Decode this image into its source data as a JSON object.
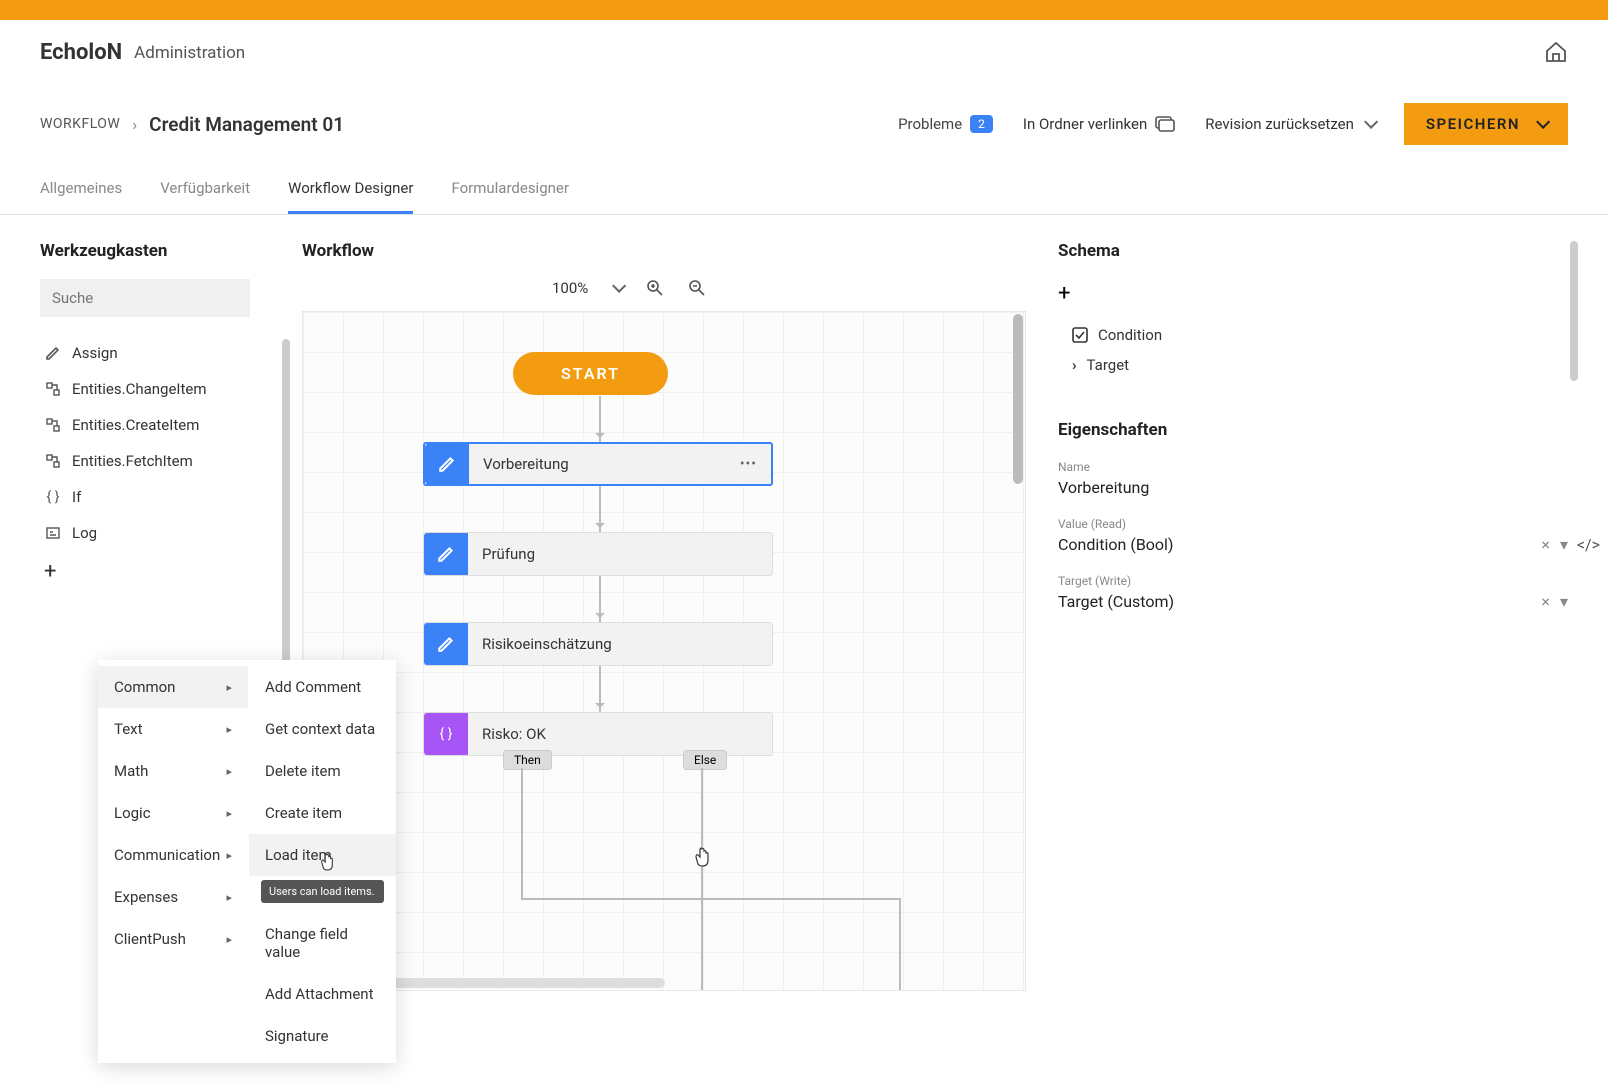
{
  "header": {
    "logo": "EcholoN",
    "admin": "Administration"
  },
  "breadcrumb": {
    "root": "WORKFLOW",
    "title": "Credit Management 01"
  },
  "toolbar": {
    "problems_label": "Probleme",
    "problems_count": "2",
    "link_folder": "In Ordner verlinken",
    "revision_reset": "Revision zurücksetzen",
    "save": "SPEICHERN"
  },
  "tabs": {
    "general": "Allgemeines",
    "availability": "Verfügbarkeit",
    "designer": "Workflow Designer",
    "form_designer": "Formulardesigner"
  },
  "toolbox": {
    "title": "Werkzeugkasten",
    "search_placeholder": "Suche",
    "items": [
      {
        "icon": "pencil",
        "label": "Assign"
      },
      {
        "icon": "entity",
        "label": "Entities.ChangeItem"
      },
      {
        "icon": "entity",
        "label": "Entities.CreateItem"
      },
      {
        "icon": "entity",
        "label": "Entities.FetchItem"
      },
      {
        "icon": "braces",
        "label": "If"
      },
      {
        "icon": "log",
        "label": "Log"
      }
    ]
  },
  "canvas": {
    "title": "Workflow",
    "zoom": "100%",
    "start": "START",
    "nodes": [
      {
        "label": "Vorbereitung",
        "selected": true,
        "menu": true
      },
      {
        "label": "Prüfung"
      },
      {
        "label": "Risikoeinschätzung"
      },
      {
        "label": "Risko: OK",
        "purple": true,
        "branches": {
          "then": "Then",
          "else": "Else"
        }
      }
    ]
  },
  "schema": {
    "title": "Schema",
    "items": [
      {
        "icon": "checkbox",
        "label": "Condition"
      },
      {
        "icon": "chevron",
        "label": "Target"
      }
    ],
    "props_title": "Eigenschaften",
    "name_label": "Name",
    "name_value": "Vorbereitung",
    "value_read_label": "Value (Read)",
    "value_read_value": "Condition (Bool)",
    "target_write_label": "Target (Write)",
    "target_write_value": "Target (Custom)"
  },
  "context_menu": {
    "categories": [
      "Common",
      "Text",
      "Math",
      "Logic",
      "Communication",
      "Expenses",
      "ClientPush"
    ],
    "sub_items": [
      "Add Comment",
      "Get context data",
      "Delete item",
      "Create item",
      "Load item"
    ],
    "tooltip": "Users can load items.",
    "sub_items_after": [
      "Change field value",
      "Add Attachment",
      "Signature"
    ]
  }
}
